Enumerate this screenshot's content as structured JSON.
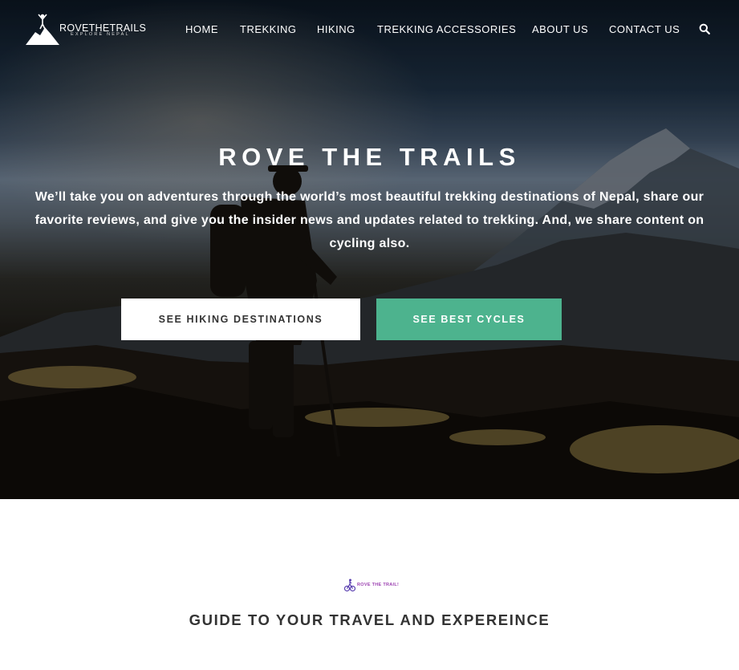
{
  "brand": {
    "name": "ROVETHETRAILS",
    "tagline": "EXPLORE NEPAL"
  },
  "nav": {
    "items": [
      {
        "label": "HOME"
      },
      {
        "label": "TREKKING"
      },
      {
        "label": "HIKING"
      },
      {
        "label": "TREKKING ACCESSORIES"
      },
      {
        "label": "ABOUT US"
      },
      {
        "label": "CONTACT US"
      }
    ],
    "search_icon": "search-icon"
  },
  "hero": {
    "title": "ROVE THE TRAILS",
    "subtitle": "We’ll take you on adventures through the world’s most beautiful trekking destinations of Nepal, share our favorite reviews, and give you the insider news and updates related to trekking. And, we share content on cycling also.",
    "primary_button": "SEE HIKING DESTINATIONS",
    "secondary_button": "SEE BEST CYCLES"
  },
  "section": {
    "logo_text": "ROVE THE TRAIL!",
    "heading": "GUIDE TO YOUR TRAVEL AND EXPEREINCE"
  },
  "colors": {
    "accent": "#4db38e",
    "text_dark": "#333333",
    "logo_purple": "#9b3fb0"
  }
}
